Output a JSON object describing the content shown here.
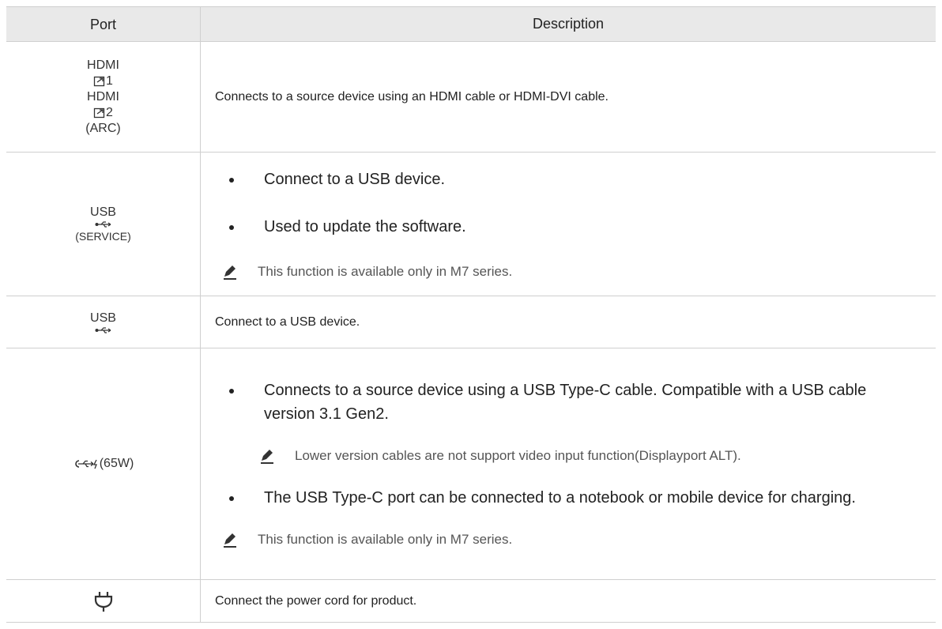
{
  "header": {
    "port": "Port",
    "description": "Description"
  },
  "rows": [
    {
      "port_lines": [
        "HDMI",
        "1",
        "HDMI",
        "2",
        "(ARC)"
      ],
      "description": "Connects to a source device using an HDMI cable or HDMI-DVI cable."
    },
    {
      "port_lines": [
        "USB",
        "(SERVICE)"
      ],
      "bullets": [
        "Connect to a USB device.",
        "Used to update the software."
      ],
      "note": "This function is available only in M7 series."
    },
    {
      "port_lines": [
        "USB"
      ],
      "description": "Connect to a USB device."
    },
    {
      "port_label": "(65W)",
      "bullets": [
        "Connects to a source device using a USB Type-C cable. Compatible with a USB cable version 3.1 Gen2.",
        "The USB Type-C port can be connected to a notebook or mobile device for charging."
      ],
      "subnote": "Lower version cables are not support video input function(Displayport ALT).",
      "note": "This function is available only in M7 series."
    },
    {
      "description": "Connect the power cord for product."
    }
  ],
  "icons": {
    "hdmi": "hdmi-input-icon",
    "usb": "usb-icon",
    "usb_c": "usb-c-charging-icon",
    "power": "power-plug-icon",
    "note": "pencil-note-icon"
  }
}
